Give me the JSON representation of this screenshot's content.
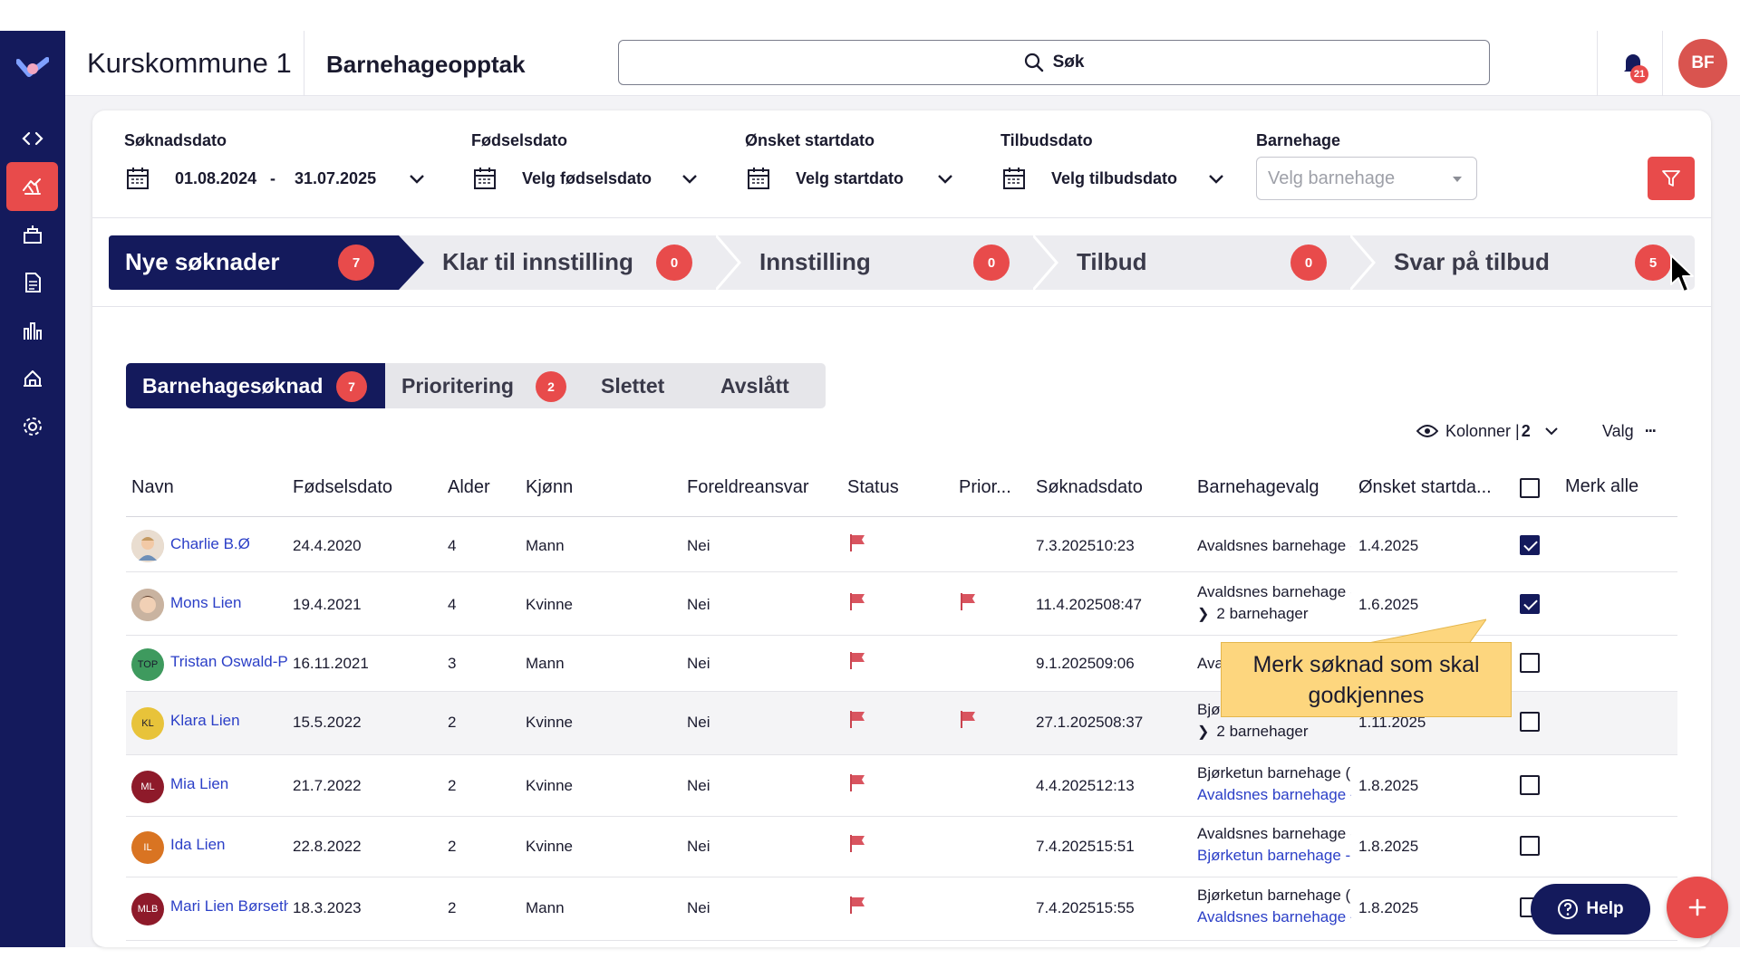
{
  "header": {
    "org_name": "Kurskommune 1",
    "module_name": "Barnehageopptak",
    "search_label": "Søk",
    "notification_count": "21",
    "user_initials": "BF"
  },
  "sidebar": {
    "items": [
      {
        "icon": "code-icon"
      },
      {
        "icon": "family-icon",
        "active": true
      },
      {
        "icon": "building-icon"
      },
      {
        "icon": "document-icon"
      },
      {
        "icon": "bar-chart-icon"
      },
      {
        "icon": "house-icon"
      },
      {
        "icon": "gear-icon"
      }
    ]
  },
  "filters": {
    "soknadsdato": {
      "label": "Søknadsdato",
      "from": "01.08.2024",
      "sep": "-",
      "to": "31.07.2025"
    },
    "fodselsdato": {
      "label": "Fødselsdato",
      "value": "Velg fødselsdato"
    },
    "startdato": {
      "label": "Ønsket startdato",
      "value": "Velg startdato"
    },
    "tilbudsdato": {
      "label": "Tilbudsdato",
      "value": "Velg tilbudsdato"
    },
    "barnehage": {
      "label": "Barnehage",
      "placeholder": "Velg barnehage"
    }
  },
  "stages": [
    {
      "label": "Nye søknader",
      "count": "7",
      "active": true
    },
    {
      "label": "Klar til innstilling",
      "count": "0"
    },
    {
      "label": "Innstilling",
      "count": "0"
    },
    {
      "label": "Tilbud",
      "count": "0"
    },
    {
      "label": "Svar på tilbud",
      "count": "5"
    }
  ],
  "subtabs": [
    {
      "label": "Barnehagesøknad",
      "count": "7",
      "active": true
    },
    {
      "label": "Prioritering",
      "count": "2"
    },
    {
      "label": "Slettet"
    },
    {
      "label": "Avslått"
    }
  ],
  "toolbar": {
    "columns_label": "Kolonner |",
    "columns_count": "2",
    "valg_label": "Valg",
    "more": "···"
  },
  "table": {
    "headers": [
      "Navn",
      "Fødselsdato",
      "Alder",
      "Kjønn",
      "Foreldreansvar",
      "Status",
      "Prior...",
      "Søknadsdato",
      "Barnehagevalg",
      "Ønsket startda...",
      "Merk alle"
    ],
    "rows": [
      {
        "initials": "",
        "avatar_color": "",
        "name": "Charlie B.Ø",
        "dob": "24.4.2020",
        "age": "4",
        "gender": "Mann",
        "parental": "Nei",
        "prio": false,
        "applied": "7.3.202510:23",
        "choice": "Avaldsnes barnehage (",
        "choice2": "",
        "start": "1.4.2025",
        "checked": true
      },
      {
        "initials": "",
        "avatar_color": "",
        "name": "Mons Lien",
        "dob": "19.4.2021",
        "age": "4",
        "gender": "Kvinne",
        "parental": "Nei",
        "prio": true,
        "applied": "11.4.202508:47",
        "choice": "Avaldsnes barnehage (",
        "choice2": "2 barnehager",
        "start": "1.6.2025",
        "checked": true
      },
      {
        "initials": "TOP",
        "avatar_color": "#3e9a5e",
        "name": "Tristan Oswald-P",
        "dob": "16.11.2021",
        "age": "3",
        "gender": "Mann",
        "parental": "Nei",
        "prio": false,
        "applied": "9.1.202509:06",
        "choice": "Ava",
        "choice2": "",
        "start": "",
        "checked": false
      },
      {
        "initials": "KL",
        "avatar_color": "#e8c33a",
        "name": "Klara Lien",
        "dob": "15.5.2022",
        "age": "2",
        "gender": "Kvinne",
        "parental": "Nei",
        "prio": true,
        "applied": "27.1.202508:37",
        "choice": "Bjør",
        "choice2": "2 barnehager",
        "start": "1.11.2025",
        "checked": false
      },
      {
        "initials": "ML",
        "avatar_color": "#8e1a2a",
        "name": "Mia Lien",
        "dob": "21.7.2022",
        "age": "2",
        "gender": "Kvinne",
        "parental": "Nei",
        "prio": false,
        "applied": "4.4.202512:13",
        "choice": "Bjørketun barnehage (",
        "choice_link": "Avaldsnes barnehage -",
        "start": "1.8.2025",
        "checked": false
      },
      {
        "initials": "IL",
        "avatar_color": "#d97422",
        "name": "Ida Lien",
        "dob": "22.8.2022",
        "age": "2",
        "gender": "Kvinne",
        "parental": "Nei",
        "prio": false,
        "applied": "7.4.202515:51",
        "choice": "Avaldsnes barnehage (",
        "choice_link": "Bjørketun barnehage -",
        "start": "1.8.2025",
        "checked": false
      },
      {
        "initials": "MLB",
        "avatar_color": "#8e1a2a",
        "name": "Mari Lien Børseth",
        "dob": "18.3.2023",
        "age": "2",
        "gender": "Mann",
        "parental": "Nei",
        "prio": false,
        "applied": "7.4.202515:55",
        "choice": "Bjørketun barnehage (",
        "choice_link": "Avaldsnes barnehage -",
        "start": "1.8.2025",
        "checked": false
      }
    ]
  },
  "tooltip": {
    "text_line1": "Merk søknad som skal",
    "text_line2": "godkjennes"
  },
  "help_button": {
    "label": "Help"
  },
  "colors": {
    "navy": "#141a5c",
    "accent_red": "#e84b4b",
    "link_blue": "#2b3fc7",
    "tooltip_yellow": "#fdd67e"
  }
}
